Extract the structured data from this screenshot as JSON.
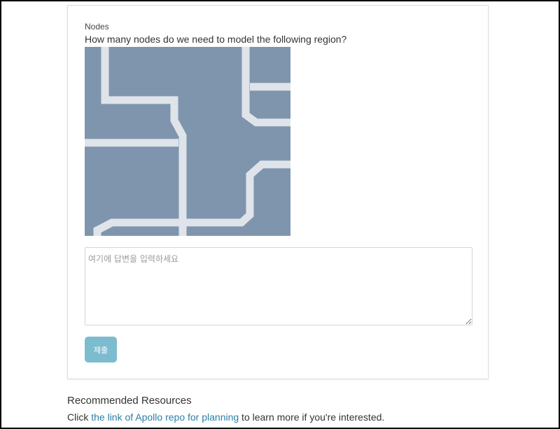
{
  "question": {
    "title": "Nodes",
    "text": "How many nodes do we need to model the following region?"
  },
  "region_image": {
    "background_color": "#7e95ad",
    "corridor_color": "#dfe4ea"
  },
  "answer_field": {
    "placeholder": "여기에 답변을 입력하세요",
    "value": ""
  },
  "submit_button": {
    "label": "제출",
    "color": "#7dbcce"
  },
  "recommended": {
    "heading": "Recommended Resources",
    "prefix": "Click ",
    "link_text": "the link of Apollo repo for planning",
    "suffix": " to learn more if you're interested.",
    "link_color": "#2c7fa6"
  }
}
